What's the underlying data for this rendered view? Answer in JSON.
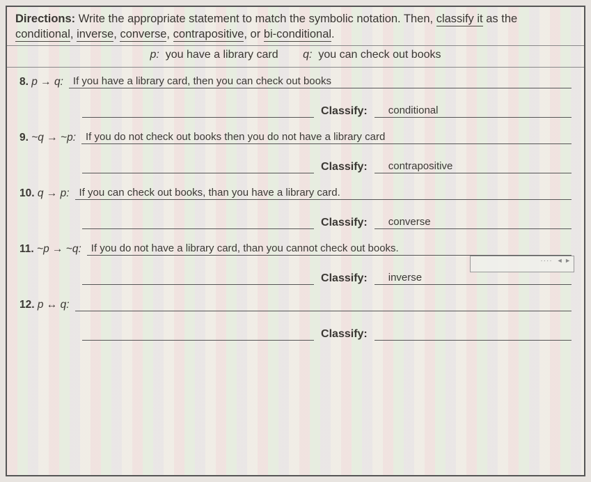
{
  "directions": {
    "label": "Directions:",
    "text_before": "Write the appropriate statement to match the symbolic notation.  Then, ",
    "classify_word": "classify it",
    "text_mid": " as the ",
    "terms": {
      "conditional": "conditional",
      "inverse": "inverse",
      "converse": "converse",
      "contrapositive": "contrapositive",
      "bicond": "bi-conditional"
    },
    "or": ", or "
  },
  "given": {
    "p_label": "p:",
    "p_text": "you have a library card",
    "q_label": "q:",
    "q_text": "you can check out books"
  },
  "labels": {
    "classify": "Classify:"
  },
  "problems": {
    "p8": {
      "num": "8.",
      "notation": "p → q:",
      "statement": "If you have a library card, then you can check out books",
      "classification": "conditional"
    },
    "p9": {
      "num": "9.",
      "notation": "~q → ~p:",
      "statement": "If you do not check out books then you do not have a library card",
      "classification": "contrapositive"
    },
    "p10": {
      "num": "10.",
      "notation": "q → p:",
      "statement": "If you can check out books, than you have a library card.",
      "classification": "converse"
    },
    "p11": {
      "num": "11.",
      "notation": "~p → ~q:",
      "statement": "If you do not have a library card, than you cannot check out books.",
      "classification": "inverse"
    },
    "p12": {
      "num": "12.",
      "notation": "p ↔ q:",
      "statement": "",
      "classification": ""
    }
  },
  "overlay": {
    "dots": "····",
    "arrows": "◄ ►"
  }
}
